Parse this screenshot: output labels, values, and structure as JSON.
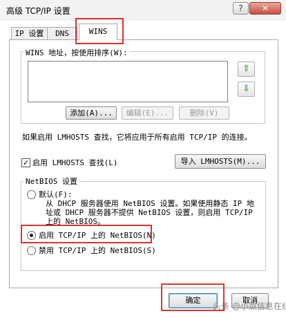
{
  "window": {
    "title": "高级 TCP/IP 设置",
    "help_label": "?",
    "close_label": "✕"
  },
  "tabs": [
    {
      "label": "IP 设置"
    },
    {
      "label": "DNS"
    },
    {
      "label": "WINS"
    }
  ],
  "wins": {
    "group_label": "WINS 地址，按使用排序(W):",
    "up_icon": "arrow-up-icon",
    "down_icon": "arrow-down-icon",
    "add_label": "添加(A)...",
    "edit_label": "编辑(E)...",
    "delete_label": "删除(V)"
  },
  "lmhosts": {
    "note": "如果启用 LMHOSTS 查找，它将应用于所有启用 TCP/IP 的连接。",
    "checkbox_label": "启用 LMHOSTS 查找(L)",
    "checkbox_checked": true,
    "import_label": "导入 LMHOSTS(M)..."
  },
  "netbios": {
    "group_label": "NetBIOS 设置",
    "default_label": "默认(F):",
    "default_desc": "从 DHCP 服务器使用 NetBIOS 设置。如果使用静态 IP 地\n址或 DHCP 服务器不提供 NetBIOS 设置，则启用 TCP/IP\n上的 NetBIOS。",
    "enable_label": "启用 TCP/IP 上的 NetBIOS(N)",
    "disable_label": "禁用 TCP/IP 上的 NetBIOS(S)",
    "selected": "enable"
  },
  "footer": {
    "ok_label": "确定",
    "cancel_label": "取消",
    "watermark": "头条 @小点信息在线"
  },
  "colors": {
    "highlight_border": "#e0312b",
    "arrow_green": "#3e9c3e"
  }
}
